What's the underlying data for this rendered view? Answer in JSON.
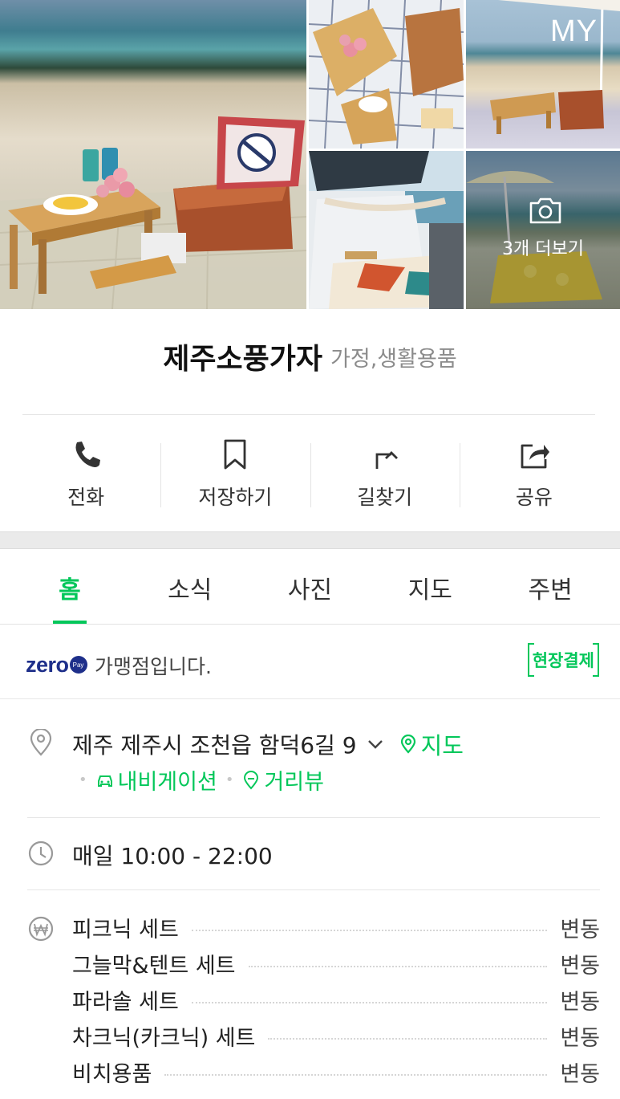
{
  "gallery": {
    "corner_label": "MY",
    "more_photos_label": "3개 더보기"
  },
  "place": {
    "name": "제주소풍가자",
    "category": "가정,생활용품"
  },
  "actions": [
    {
      "label": "전화",
      "icon": "phone-icon"
    },
    {
      "label": "저장하기",
      "icon": "bookmark-icon"
    },
    {
      "label": "길찾기",
      "icon": "directions-icon"
    },
    {
      "label": "공유",
      "icon": "share-icon"
    }
  ],
  "tabs": [
    {
      "label": "홈",
      "active": true
    },
    {
      "label": "소식",
      "active": false
    },
    {
      "label": "사진",
      "active": false
    },
    {
      "label": "지도",
      "active": false
    },
    {
      "label": "주변",
      "active": false
    }
  ],
  "zeropay": {
    "logo": "zero",
    "logo_badge": "Pay",
    "text": "가맹점입니다.",
    "badge": "현장결제"
  },
  "address": {
    "text": "제주 제주시 조천읍 함덕6길 9",
    "map_link": "지도",
    "navigation_link": "내비게이션",
    "street_view_link": "거리뷰"
  },
  "hours": {
    "text": "매일 10:00 - 22:00"
  },
  "menu": [
    {
      "name": "피크닉 세트",
      "price": "변동"
    },
    {
      "name": "그늘막&텐트 세트",
      "price": "변동"
    },
    {
      "name": "파라솔 세트",
      "price": "변동"
    },
    {
      "name": "차크닉(카크닉) 세트",
      "price": "변동"
    },
    {
      "name": "비치용품",
      "price": "변동"
    }
  ],
  "colors": {
    "accent_green": "#03c75a",
    "zeropay_navy": "#1e2f8a"
  }
}
